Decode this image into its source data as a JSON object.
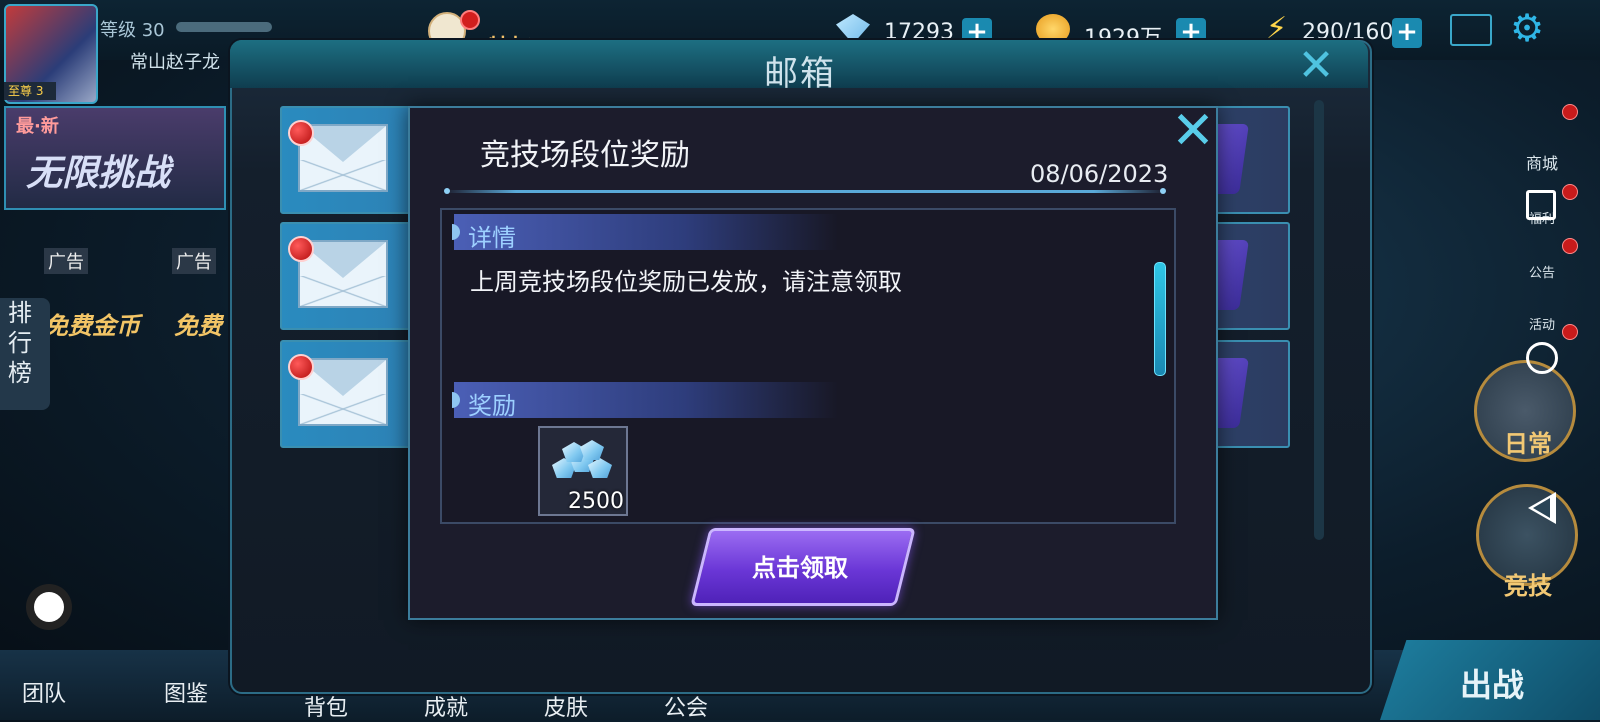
{
  "hud": {
    "level_label": "等级 30",
    "player_name": "常山赵子龙",
    "vip_label": "至尊 3",
    "privilege_label": "特权",
    "diamonds": "17293",
    "gold": "1929万",
    "energy": "290/160",
    "plus": "+"
  },
  "left": {
    "event_new": "最·新",
    "event_title": "无限挑战",
    "ad_label": "广告",
    "free_gold": "免费金币",
    "free_other": "免费",
    "rank_tab": [
      "排",
      "行",
      "榜"
    ]
  },
  "right_menu": {
    "shop": "商城",
    "welfare": "福利",
    "notice": "公告",
    "activity": "活动",
    "daily": "日常",
    "arena": "竞技"
  },
  "bottom_bar": {
    "team": "团队",
    "codex": "图鉴",
    "bag": "背包",
    "achievement": "成就",
    "skin": "皮肤",
    "guild": "公会",
    "battle": "出战"
  },
  "mailbox": {
    "title": "邮箱",
    "close": "✕",
    "rows": [
      {
        "unread": true
      },
      {
        "unread": true
      },
      {
        "unread": true
      }
    ]
  },
  "detail": {
    "title": "竞技场段位奖励",
    "date": "08/06/2023",
    "close": "✕",
    "section_detail": "详情",
    "body": "上周竞技场段位奖励已发放，请注意领取",
    "section_reward": "奖励",
    "reward_qty": "2500",
    "reward_icon": "diamond-pile-icon",
    "claim_button": "点击领取"
  },
  "colors": {
    "accent": "#3aa7c9",
    "claim": "#6a36d6",
    "unread": "#c81b1b"
  }
}
